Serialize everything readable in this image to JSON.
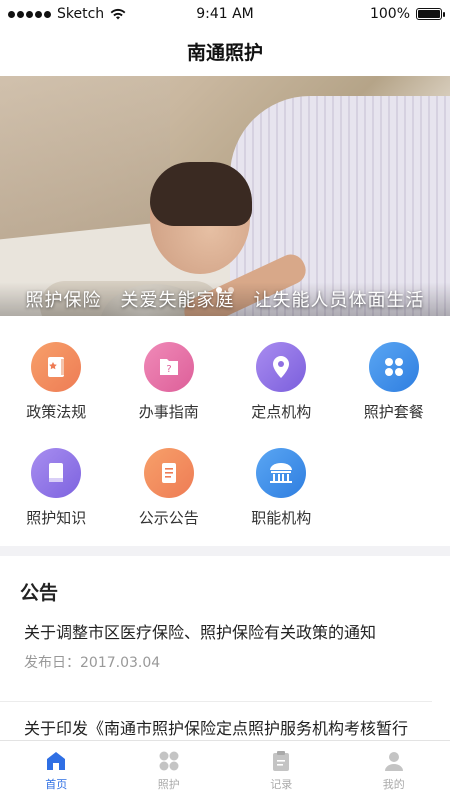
{
  "status_bar": {
    "carrier": "Sketch",
    "time": "9:41 AM",
    "battery": "100%"
  },
  "nav": {
    "title": "南通照护"
  },
  "banner": {
    "caption": "照护保险　关爱失能家庭　让失能人员体面生活",
    "slide_count": 2,
    "active_slide": 1
  },
  "grid": {
    "items": [
      {
        "label": "政策法规",
        "icon": "policy-book-icon",
        "color": "#f08a5d"
      },
      {
        "label": "办事指南",
        "icon": "guide-book-icon",
        "color": "#e66fa4"
      },
      {
        "label": "定点机构",
        "icon": "location-pin-icon",
        "color": "#8f6fe2"
      },
      {
        "label": "照护套餐",
        "icon": "grid-clover-icon",
        "color": "#3d8de8"
      },
      {
        "label": "照护知识",
        "icon": "knowledge-book-icon",
        "color": "#8e74e6"
      },
      {
        "label": "公示公告",
        "icon": "notice-document-icon",
        "color": "#f08a5d"
      },
      {
        "label": "职能机构",
        "icon": "building-icon",
        "color": "#3d8de8"
      }
    ]
  },
  "notices": {
    "heading": "公告",
    "items": [
      {
        "title": "关于调整市区医疗保险、照护保险有关政策的通知",
        "date": "发布日：2017.03.04"
      },
      {
        "title": "关于印发《南通市照护保险定点照护服务机构考核暂行办法》的通知",
        "date": ""
      }
    ]
  },
  "tabs": [
    {
      "label": "首页",
      "icon": "home-icon",
      "active": true
    },
    {
      "label": "照护",
      "icon": "care-grid-icon",
      "active": false
    },
    {
      "label": "记录",
      "icon": "clipboard-icon",
      "active": false
    },
    {
      "label": "我的",
      "icon": "user-icon",
      "active": false
    }
  ],
  "colors": {
    "accent": "#2f6fe4",
    "inactive": "#aaaaaa"
  }
}
